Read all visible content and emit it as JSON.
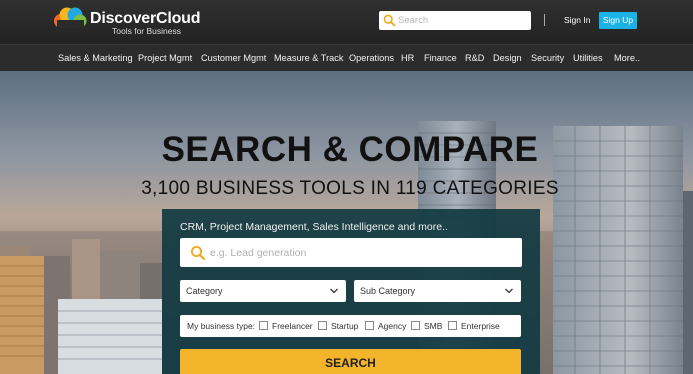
{
  "header": {
    "brand_name": "DiscoverCloud",
    "brand_tagline": "Tools for Business",
    "search_placeholder": "Search",
    "signin_label": "Sign In",
    "signup_label": "Sign Up",
    "signup_color": "#1bb3e6"
  },
  "nav": {
    "items": [
      "Sales & Marketing",
      "Project Mgmt",
      "Customer Mgmt",
      "Measure & Track",
      "Operations",
      "HR",
      "Finance",
      "R&D",
      "Design",
      "Security",
      "Utilities",
      "More.."
    ]
  },
  "hero": {
    "headline": "SEARCH & COMPARE",
    "subline": "3,100 BUSINESS TOOLS IN 119 CATEGORIES",
    "hint": "CRM, Project Management, Sales Intelligence and more..",
    "search_placeholder": "e.g. Lead generation",
    "category_label": "Category",
    "subcategory_label": "Sub Category",
    "business_type_label": "My business type:",
    "business_types": [
      "Freelancer",
      "Startup",
      "Agency",
      "SMB",
      "Enterprise"
    ],
    "search_button": "SEARCH",
    "button_color": "#f3b32b"
  }
}
